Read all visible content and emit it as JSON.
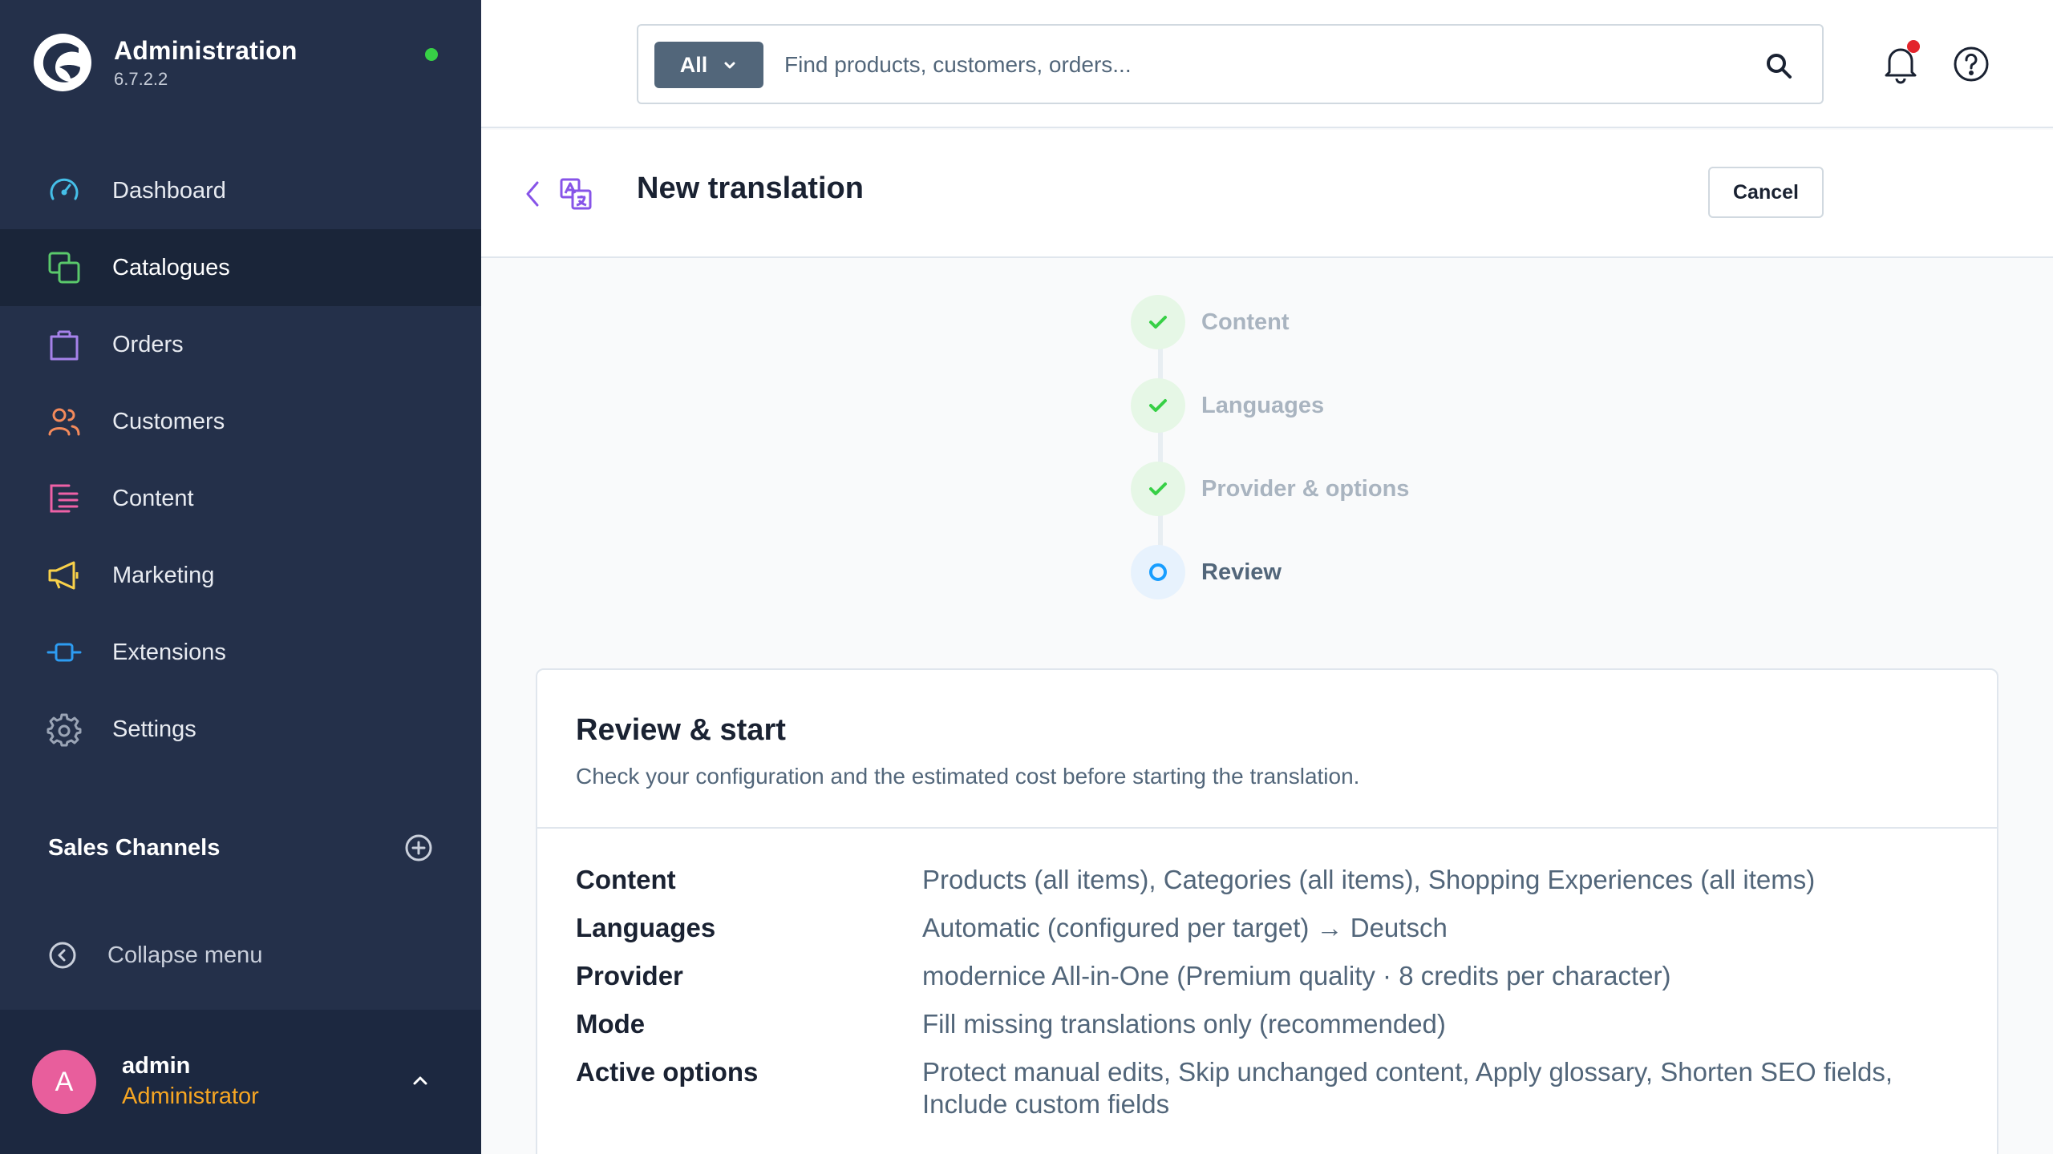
{
  "app": {
    "title": "Administration",
    "version": "6.7.2.2"
  },
  "sidebar": {
    "items": [
      {
        "label": "Dashboard",
        "icon": "dashboard-icon",
        "color": "#45bfe8"
      },
      {
        "label": "Catalogues",
        "icon": "catalogues-icon",
        "color": "#5ac96b",
        "active": true
      },
      {
        "label": "Orders",
        "icon": "orders-icon",
        "color": "#a682ea"
      },
      {
        "label": "Customers",
        "icon": "customers-icon",
        "color": "#f48a5b"
      },
      {
        "label": "Content",
        "icon": "content-icon",
        "color": "#ee61a6"
      },
      {
        "label": "Marketing",
        "icon": "marketing-icon",
        "color": "#f9d14a"
      },
      {
        "label": "Extensions",
        "icon": "extensions-icon",
        "color": "#2d9cf2"
      },
      {
        "label": "Settings",
        "icon": "settings-icon",
        "color": "#9aa4b5"
      }
    ],
    "sales_channels_label": "Sales Channels",
    "collapse_label": "Collapse menu"
  },
  "user": {
    "initial": "A",
    "name": "admin",
    "role": "Administrator"
  },
  "search": {
    "type_label": "All",
    "placeholder": "Find products, customers, orders..."
  },
  "page": {
    "title": "New translation",
    "cancel_label": "Cancel"
  },
  "steps": [
    {
      "label": "Content",
      "state": "done"
    },
    {
      "label": "Languages",
      "state": "done"
    },
    {
      "label": "Provider & options",
      "state": "done"
    },
    {
      "label": "Review",
      "state": "current"
    }
  ],
  "review": {
    "title": "Review & start",
    "subtitle": "Check your configuration and the estimated cost before starting the translation.",
    "rows": [
      {
        "key": "Content",
        "value": "Products (all items), Categories (all items), Shopping Experiences (all items)"
      },
      {
        "key": "Languages",
        "value": "Automatic (configured per target) → Deutsch"
      },
      {
        "key": "Provider",
        "value": "modernice All-in-One (Premium quality · 8 credits per character)"
      },
      {
        "key": "Mode",
        "value": "Fill missing translations only (recommended)"
      },
      {
        "key": "Active options",
        "value": "Protect manual edits, Skip unchanged content, Apply glossary, Shorten SEO fields, Include custom fields"
      }
    ]
  },
  "colors": {
    "sidebar_bg": "#24304a",
    "accent": "#189eff",
    "success": "#37d046",
    "user_role": "#f6a623"
  }
}
